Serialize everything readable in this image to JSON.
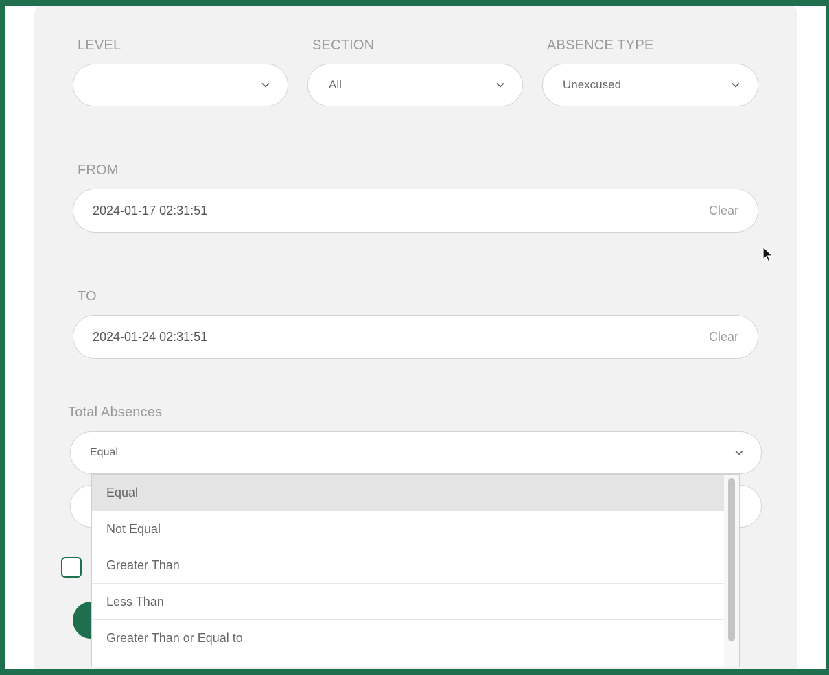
{
  "filters": {
    "level": {
      "label": "LEVEL",
      "value": ""
    },
    "section": {
      "label": "SECTION",
      "value": "All"
    },
    "absence_type": {
      "label": "ABSENCE TYPE",
      "value": "Unexcused"
    }
  },
  "date_range": {
    "from": {
      "label": "FROM",
      "value": "2024-01-17 02:31:51",
      "clear_label": "Clear"
    },
    "to": {
      "label": "TO",
      "value": "2024-01-24 02:31:51",
      "clear_label": "Clear"
    }
  },
  "total_absences": {
    "label": "Total Absences",
    "operator_value": "Equal",
    "options": [
      "Equal",
      "Not Equal",
      "Greater Than",
      "Less Than",
      "Greater Than or Equal to"
    ]
  },
  "colors": {
    "accent": "#1f6f4e",
    "panel": "#f2f2f2"
  }
}
